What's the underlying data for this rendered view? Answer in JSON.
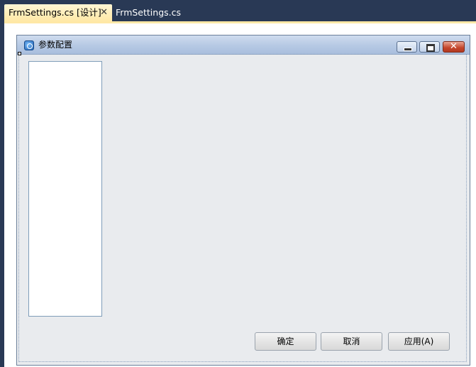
{
  "tabs": [
    {
      "label": "FrmSettings.cs [设计]",
      "active": true
    },
    {
      "label": "FrmSettings.cs",
      "active": false
    }
  ],
  "form": {
    "title": "参数配置",
    "window_controls": {
      "minimize": "minimize",
      "maximize": "maximize",
      "close": "✕"
    }
  },
  "buttons": {
    "ok_label": "确定",
    "cancel_label": "取消",
    "apply_label": "应用(A)"
  },
  "colors": {
    "ide_background": "#293955",
    "active_tab": "#ffe8a6",
    "form_background": "#e9ebee",
    "close_button": "#c4452b"
  }
}
